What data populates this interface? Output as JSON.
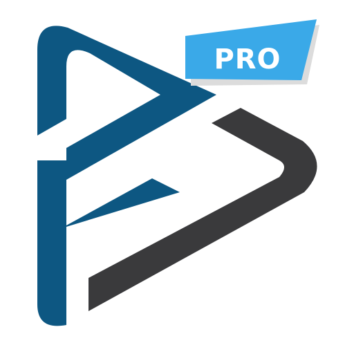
{
  "app_icon": {
    "badge_label": "PRO",
    "colors": {
      "background": "#ffffff",
      "primary_mark": "#0d5782",
      "secondary_mark": "#3a3a3c",
      "badge_fill": "#3aa9e8",
      "badge_shadow": "#dcdcdc",
      "badge_text": "#ffffff"
    }
  }
}
